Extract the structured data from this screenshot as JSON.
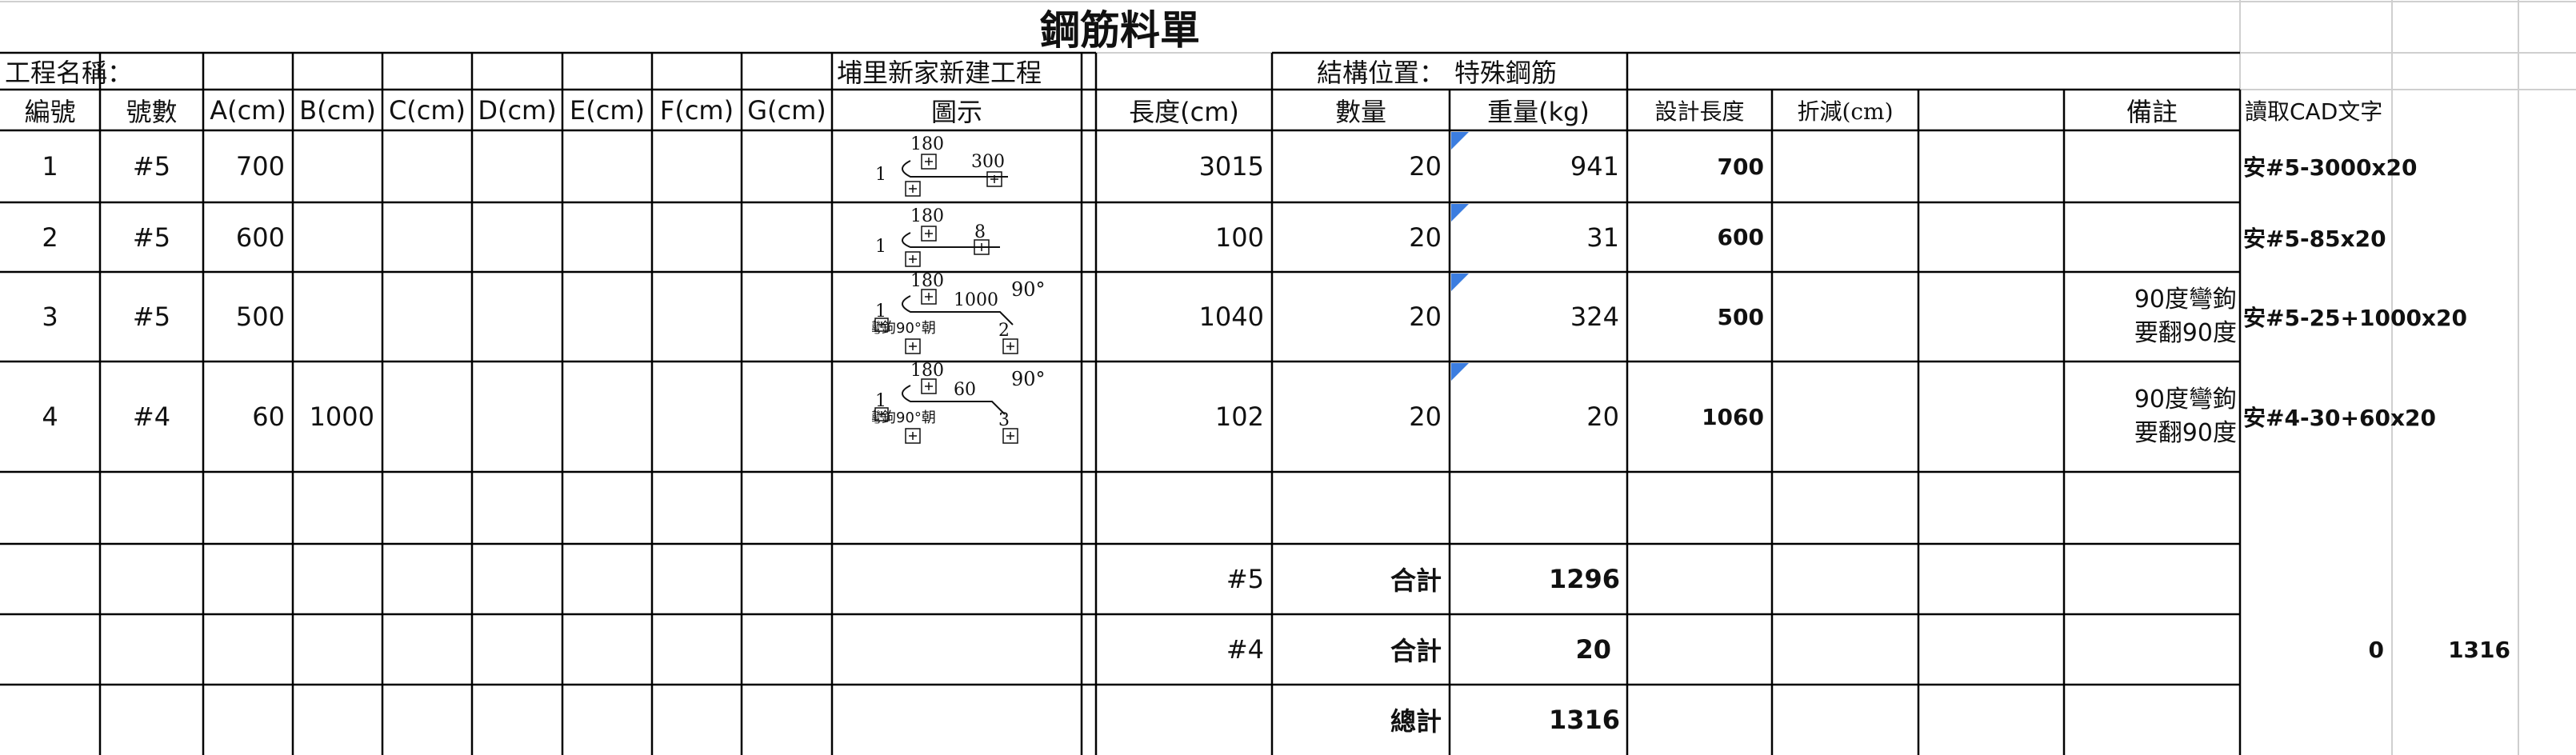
{
  "title": "鋼筋料單",
  "project_label": "工程名稱：",
  "project_name": "埔里新家新建工程",
  "location_label": "結構位置：",
  "location_value": "特殊鋼筋",
  "headers": {
    "no": "編號",
    "size": "號數",
    "a": "A(cm)",
    "b": "B(cm)",
    "c": "C(cm)",
    "d": "D(cm)",
    "e": "E(cm)",
    "f": "F(cm)",
    "g": "G(cm)",
    "diagram": "圖示",
    "length": "長度(cm)",
    "qty": "數量",
    "weight": "重量(kg)",
    "design_len": "設計長度",
    "reduction": "折減(cm)",
    "remark": "備註",
    "cad": "讀取CAD文字"
  },
  "rows": [
    {
      "no": "1",
      "size": "#5",
      "a": "700",
      "b": "",
      "length": "3015",
      "qty": "20",
      "weight": "941",
      "design_len": "700",
      "remark1": "",
      "remark2": "",
      "cad": "安#5-3000x20",
      "diagram": {
        "left": "1",
        "top": "180",
        "right": "300",
        "angle": "",
        "bottom": "",
        "caption": ""
      }
    },
    {
      "no": "2",
      "size": "#5",
      "a": "600",
      "b": "",
      "length": "100",
      "qty": "20",
      "weight": "31",
      "design_len": "600",
      "remark1": "",
      "remark2": "",
      "cad": "安#5-85x20",
      "diagram": {
        "left": "1",
        "top": "180",
        "right": "8",
        "angle": "",
        "bottom": "",
        "caption": ""
      }
    },
    {
      "no": "3",
      "size": "#5",
      "a": "500",
      "b": "",
      "length": "1040",
      "qty": "20",
      "weight": "324",
      "design_len": "500",
      "remark1": "90度彎鉤",
      "remark2": "要翻90度",
      "cad": "安#5-25+1000x20",
      "diagram": {
        "left": "1",
        "top": "180",
        "right": "1000",
        "angle": "90°",
        "bottom": "2",
        "caption": "彎鉤90°朝"
      }
    },
    {
      "no": "4",
      "size": "#4",
      "a": "60",
      "b": "1000",
      "length": "102",
      "qty": "20",
      "weight": "20",
      "design_len": "1060",
      "remark1": "90度彎鉤",
      "remark2": "要翻90度",
      "cad": "安#4-30+60x20",
      "diagram": {
        "left": "1",
        "top": "180",
        "right": "60",
        "angle": "90°",
        "bottom": "3",
        "caption": "彎鉤90°朝"
      }
    }
  ],
  "totals": {
    "size5": "#5",
    "size4": "#4",
    "subtotal_label": "合計",
    "grand_label": "總計",
    "sum5": "1296",
    "sum4": "20",
    "grand": "1316",
    "extra_zero": "0",
    "extra_total": "1316"
  },
  "colors": {
    "grid": "#000000",
    "light_grid": "#cfcfcf",
    "comment_flag": "#3b7de0"
  }
}
